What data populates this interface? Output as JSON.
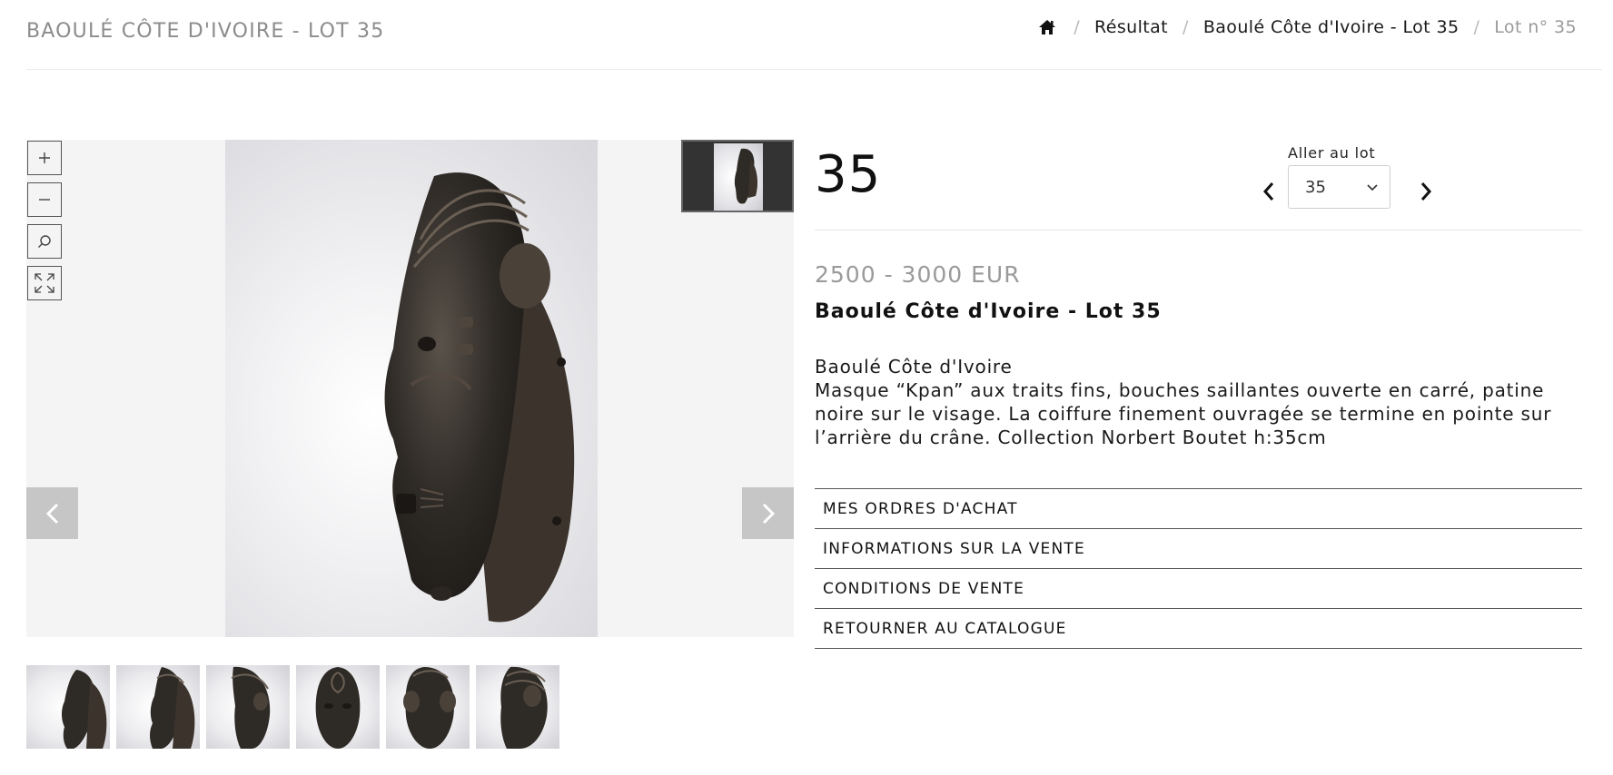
{
  "header": {
    "title": "BAOULÉ CÔTE D'IVOIRE - LOT 35"
  },
  "breadcrumb": {
    "home_icon": "home-icon",
    "items": [
      "Résultat",
      "Baoulé Côte d'Ivoire - Lot 35"
    ],
    "current": "Lot n° 35"
  },
  "viewer": {
    "zoom_in_label": "+",
    "zoom_out_label": "−",
    "icons": [
      "zoom-in-icon",
      "zoom-out-icon",
      "magnifier-icon",
      "fullscreen-icon",
      "chevron-left-icon",
      "chevron-right-icon"
    ],
    "thumbnail_count": 6
  },
  "lot": {
    "number": "35",
    "goto_label": "Aller au lot",
    "goto_value": "35",
    "estimate": "2500 - 3000 EUR",
    "title": "Baoulé Côte d'Ivoire - Lot 35",
    "description_line1": "Baoulé Côte d'Ivoire",
    "description_body": "Masque “Kpan” aux traits fins, bouches saillantes ouverte en carré, patine noire sur le visage. La coiffure finement ouvragée se termine en pointe sur l’arrière du crâne. Collection Norbert Boutet h:35cm"
  },
  "actions": [
    {
      "label": "MES ORDRES D'ACHAT"
    },
    {
      "label": "INFORMATIONS SUR LA VENTE"
    },
    {
      "label": "CONDITIONS DE VENTE"
    },
    {
      "label": "RETOURNER AU CATALOGUE"
    }
  ],
  "colors": {
    "muted_text": "#8c8c8c",
    "viewer_bg": "#f4f4f4",
    "arrow_bg": "#c6c6c6",
    "mask_dark": "#2e2a26"
  }
}
